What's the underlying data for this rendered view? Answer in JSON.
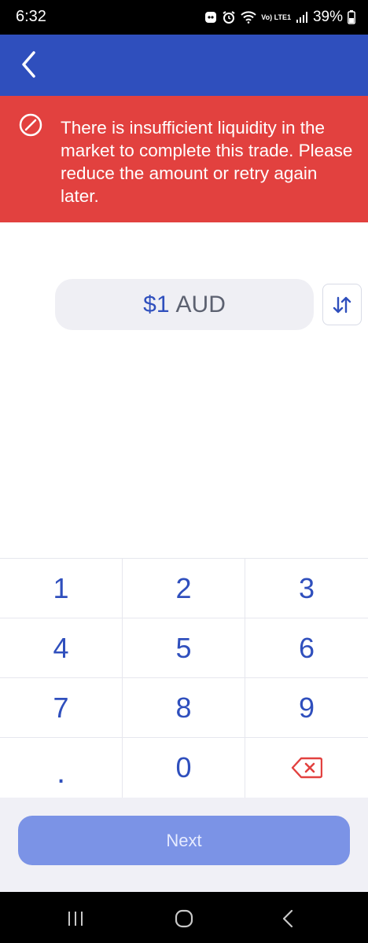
{
  "status_bar": {
    "time": "6:32",
    "network_label": "Vo) LTE1",
    "battery": "39%"
  },
  "error": {
    "message": "There is insufficient liquidity in the market to complete this trade. Please reduce the amount or retry again later."
  },
  "amount": {
    "value": "$1",
    "currency": "AUD"
  },
  "keypad": {
    "keys": [
      "1",
      "2",
      "3",
      "4",
      "5",
      "6",
      "7",
      "8",
      "9",
      ".",
      "0"
    ]
  },
  "actions": {
    "next_label": "Next"
  },
  "colors": {
    "header": "#2f4fbd",
    "error": "#e2413f",
    "accent": "#2f4fbd",
    "next_button": "#7b93e6",
    "delete_icon": "#e2413f"
  }
}
